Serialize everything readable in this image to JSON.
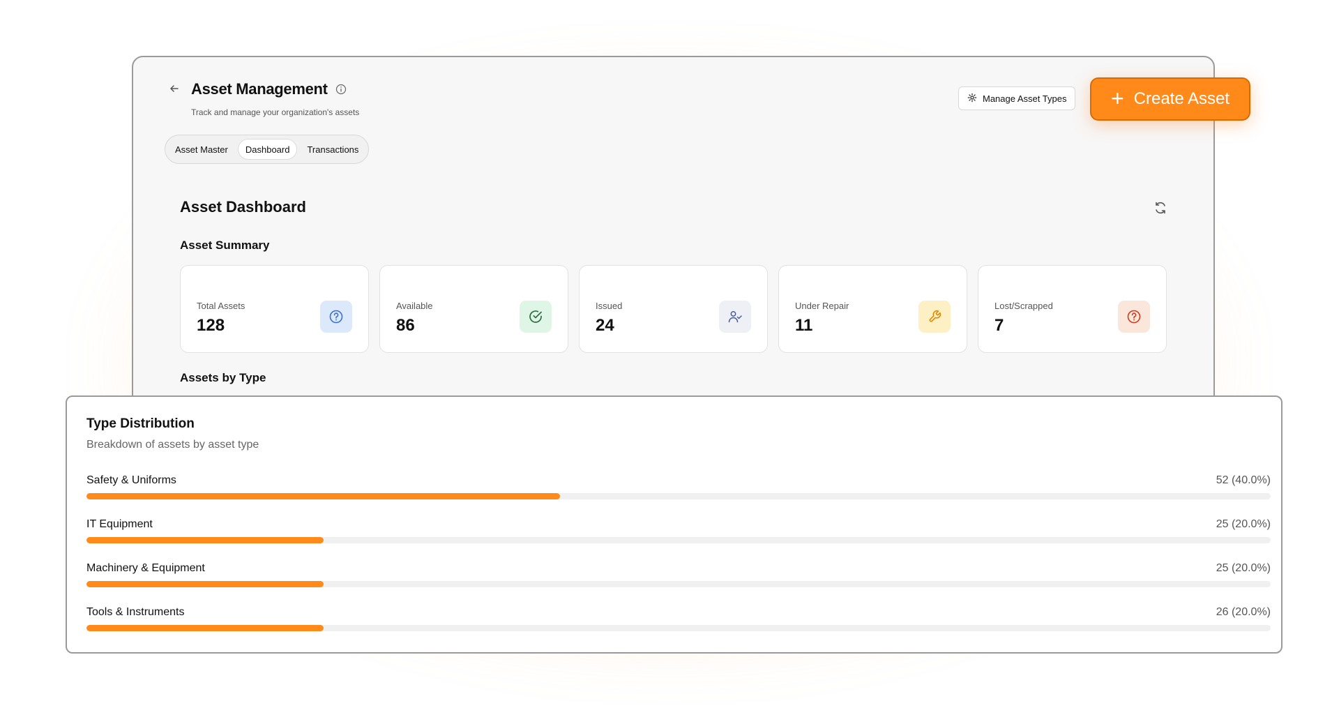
{
  "header": {
    "title": "Asset Management",
    "subtitle": "Track and manage your organization's assets",
    "manage_label": "Manage Asset Types",
    "create_label": "Create Asset"
  },
  "tabs": [
    {
      "label": "Asset Master",
      "active": false
    },
    {
      "label": "Dashboard",
      "active": true
    },
    {
      "label": "Transactions",
      "active": false
    }
  ],
  "dashboard": {
    "title": "Asset Dashboard",
    "summary_title": "Asset Summary",
    "bytype_title": "Assets by Type"
  },
  "cards": [
    {
      "label": "Total Assets",
      "value": "128",
      "icon": "question-circle-icon",
      "icon_bg": "#dce9fb",
      "icon_color": "#3b6fd6"
    },
    {
      "label": "Available",
      "value": "86",
      "icon": "check-circle-icon",
      "icon_bg": "#dff5e6",
      "icon_color": "#2e8a4f"
    },
    {
      "label": "Issued",
      "value": "24",
      "icon": "user-check-icon",
      "icon_bg": "#eef0f6",
      "icon_color": "#4a5a9a"
    },
    {
      "label": "Under Repair",
      "value": "11",
      "icon": "wrench-icon",
      "icon_bg": "#fdf0c4",
      "icon_color": "#e08a00"
    },
    {
      "label": "Lost/Scrapped",
      "value": "7",
      "icon": "alert-circle-icon",
      "icon_bg": "#fbe6dc",
      "icon_color": "#d13a1e"
    }
  ],
  "distribution": {
    "title": "Type Distribution",
    "subtitle": "Breakdown of assets by asset type",
    "accent": "#ff8a1a",
    "rows": [
      {
        "name": "Safety & Uniforms",
        "value": "52 (40.0%)",
        "fraction": 0.4
      },
      {
        "name": "IT Equipment",
        "value": "25 (20.0%)",
        "fraction": 0.2
      },
      {
        "name": "Machinery & Equipment",
        "value": "25 (20.0%)",
        "fraction": 0.2
      },
      {
        "name": "Tools & Instruments",
        "value": "26 (20.0%)",
        "fraction": 0.2
      }
    ]
  }
}
